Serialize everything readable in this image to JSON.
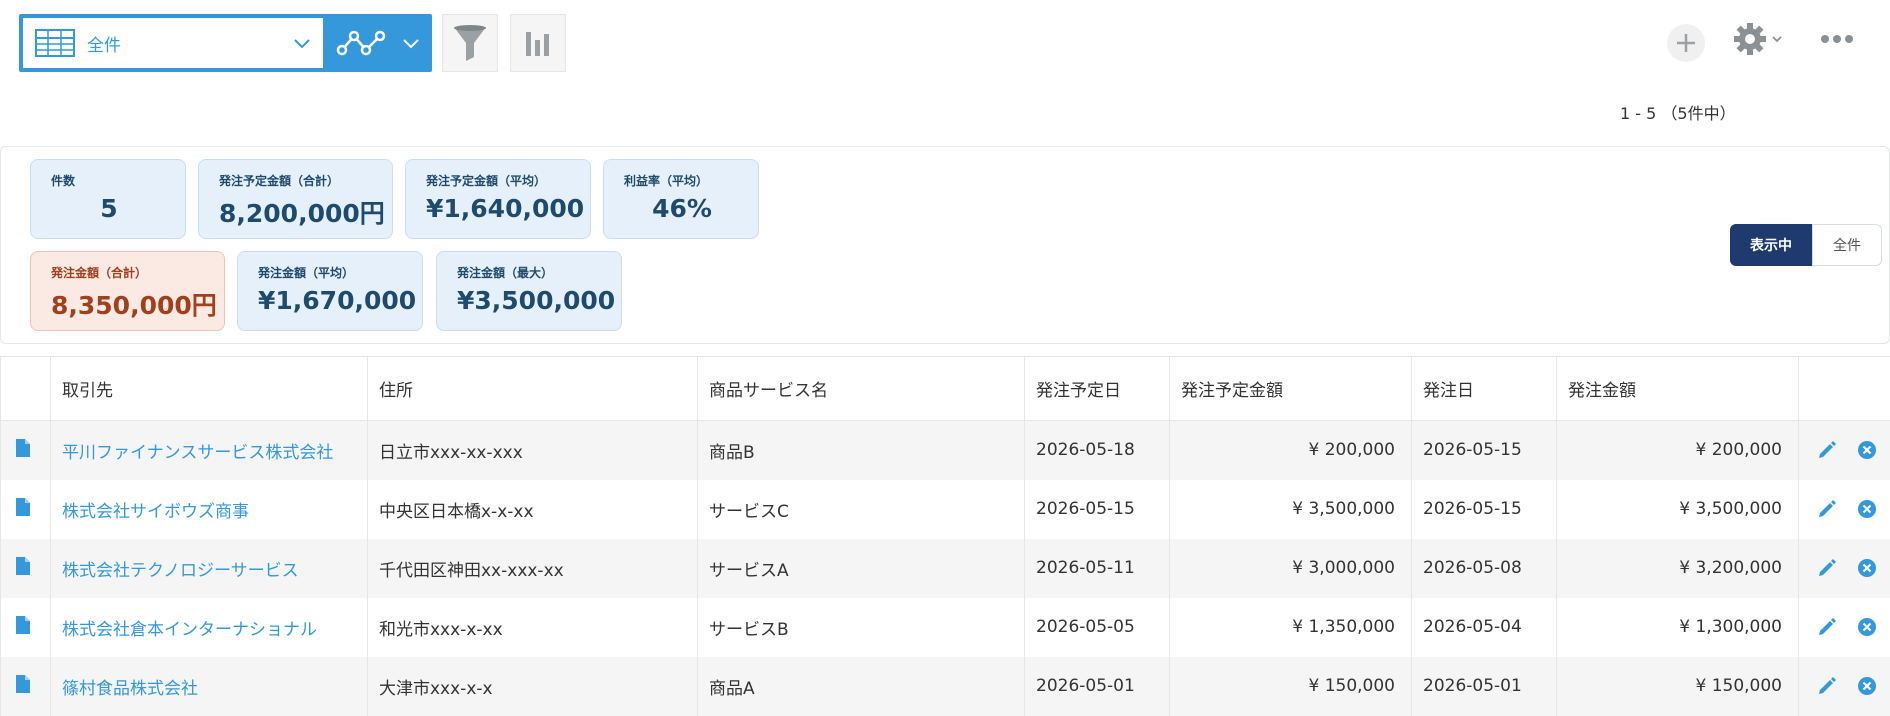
{
  "toolbar": {
    "view_label": "全件",
    "icons": [
      "table-view-icon",
      "chevron-down-icon",
      "line-graph-icon",
      "filter-icon",
      "bar-chart-icon",
      "plus-icon",
      "gear-icon",
      "more-icon"
    ]
  },
  "paging": "1 - 5 （5件中）",
  "aggregates": [
    {
      "title": "件数",
      "value": "5",
      "style": "normal"
    },
    {
      "title": "発注予定金額（合計）",
      "value": "8,200,000円",
      "style": "normal"
    },
    {
      "title": "発注予定金額（平均）",
      "value": "¥1,640,000",
      "style": "normal"
    },
    {
      "title": "利益率（平均）",
      "value": "46%",
      "style": "normal"
    },
    {
      "title": "発注金額（合計）",
      "value": "8,350,000円",
      "style": "warn"
    },
    {
      "title": "発注金額（平均）",
      "value": "¥1,670,000",
      "style": "normal"
    },
    {
      "title": "発注金額（最大）",
      "value": "¥3,500,000",
      "style": "normal"
    }
  ],
  "scope_toggle": {
    "active": "表示中",
    "inactive": "全件"
  },
  "colors": {
    "accent": "#3498db",
    "navy": "#1e3a6e",
    "warn": "#a0401c"
  },
  "table": {
    "columns": [
      "取引先",
      "住所",
      "商品サービス名",
      "発注予定日",
      "発注予定金額",
      "発注日",
      "発注金額"
    ],
    "rows": [
      [
        "平川ファイナンスサービス株式会社",
        "日立市xxx-xx-xxx",
        "商品B",
        "2026-05-18",
        "¥ 200,000",
        "2026-05-15",
        "¥ 200,000"
      ],
      [
        "株式会社サイボウズ商事",
        "中央区日本橋x-x-xx",
        "サービスC",
        "2026-05-15",
        "¥ 3,500,000",
        "2026-05-15",
        "¥ 3,500,000"
      ],
      [
        "株式会社テクノロジーサービス",
        "千代田区神田xx-xxx-xx",
        "サービスA",
        "2026-05-11",
        "¥ 3,000,000",
        "2026-05-08",
        "¥ 3,200,000"
      ],
      [
        "株式会社倉本インターナショナル",
        "和光市xxx-x-xx",
        "サービスB",
        "2026-05-05",
        "¥ 1,350,000",
        "2026-05-04",
        "¥ 1,300,000"
      ],
      [
        "篠村食品株式会社",
        "大津市xxx-x-x",
        "商品A",
        "2026-05-01",
        "¥ 150,000",
        "2026-05-01",
        "¥ 150,000"
      ]
    ]
  }
}
